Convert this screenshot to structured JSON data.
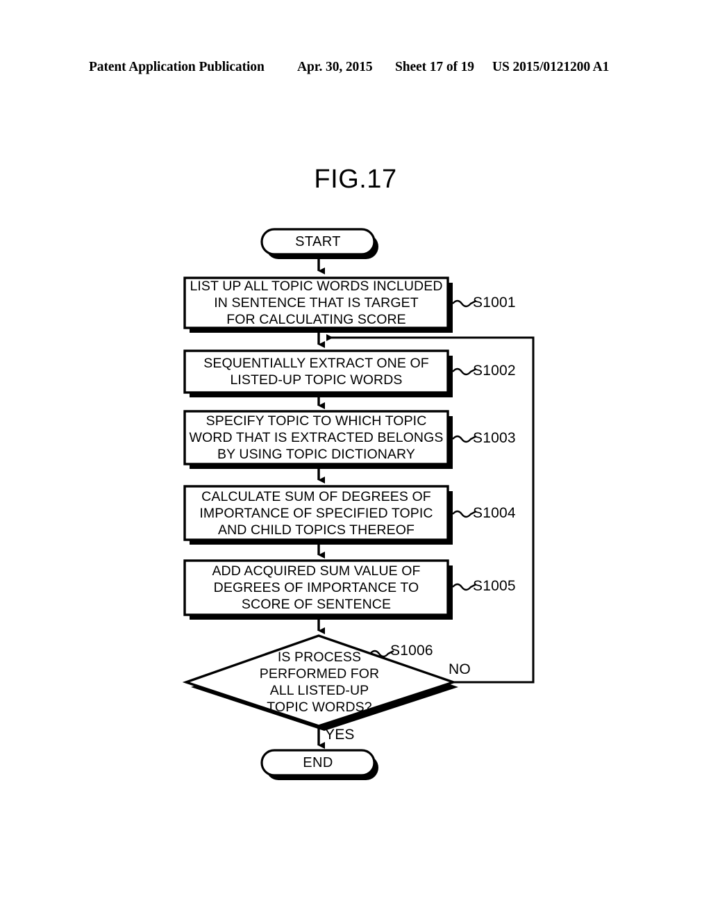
{
  "header": {
    "publication": "Patent Application Publication",
    "date": "Apr. 30, 2015",
    "sheet": "Sheet 17 of 19",
    "document_number": "US 2015/0121200 A1"
  },
  "figure": {
    "title": "FIG.17"
  },
  "flowchart": {
    "start": {
      "label": "START"
    },
    "end": {
      "label": "END"
    },
    "steps": [
      {
        "id": "S1001",
        "text": "LIST UP ALL TOPIC WORDS INCLUDED\nIN SENTENCE THAT IS TARGET\nFOR CALCULATING SCORE",
        "ref": "S1001"
      },
      {
        "id": "S1002",
        "text": "SEQUENTIALLY EXTRACT ONE OF\nLISTED-UP TOPIC WORDS",
        "ref": "S1002"
      },
      {
        "id": "S1003",
        "text": "SPECIFY TOPIC TO WHICH TOPIC\nWORD THAT IS EXTRACTED BELONGS\nBY USING TOPIC DICTIONARY",
        "ref": "S1003"
      },
      {
        "id": "S1004",
        "text": "CALCULATE SUM OF DEGREES OF\nIMPORTANCE OF SPECIFIED TOPIC\nAND CHILD TOPICS THEREOF",
        "ref": "S1004"
      },
      {
        "id": "S1005",
        "text": "ADD ACQUIRED SUM VALUE OF\nDEGREES OF IMPORTANCE TO\nSCORE OF SENTENCE",
        "ref": "S1005"
      }
    ],
    "decision": {
      "id": "S1006",
      "text": "IS PROCESS\nPERFORMED FOR\nALL LISTED-UP\nTOPIC WORDS?",
      "ref": "S1006",
      "branch_yes": "YES",
      "branch_no": "NO"
    },
    "colors": {
      "stroke": "#000000",
      "fill": "#ffffff",
      "shadow": "#000000"
    }
  }
}
